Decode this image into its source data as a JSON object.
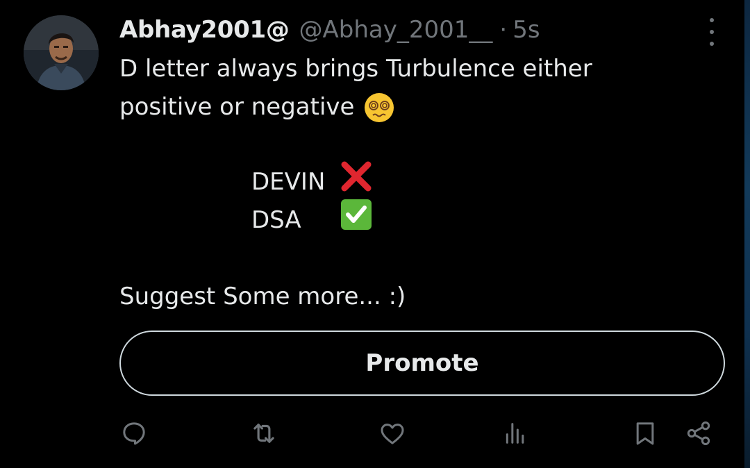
{
  "tweet": {
    "display_name": "Abhay2001@",
    "handle": "@Abhay_2001__",
    "separator": "·",
    "time": "5s",
    "text_line1": "D letter always brings Turbulence either",
    "text_line2": "positive or negative",
    "list": [
      {
        "label": "DEVIN",
        "mark": "cross-mark-emoji"
      },
      {
        "label": "DSA",
        "mark": "check-mark-emoji"
      }
    ],
    "suggest": "Suggest Some more... :)",
    "promote_label": "Promote"
  },
  "icons": {
    "more": "more-vertical-icon",
    "reply": "reply-icon",
    "retweet": "retweet-icon",
    "like": "like-icon",
    "views": "views-icon",
    "bookmark": "bookmark-icon",
    "share": "share-icon",
    "text_emoji": "dizzy-face-emoji"
  },
  "colors": {
    "background": "#000000",
    "text": "#e7e9ea",
    "muted": "#71767b",
    "button_border": "#cfd9de",
    "cross": "#e0262f",
    "check": "#5bb73a"
  }
}
